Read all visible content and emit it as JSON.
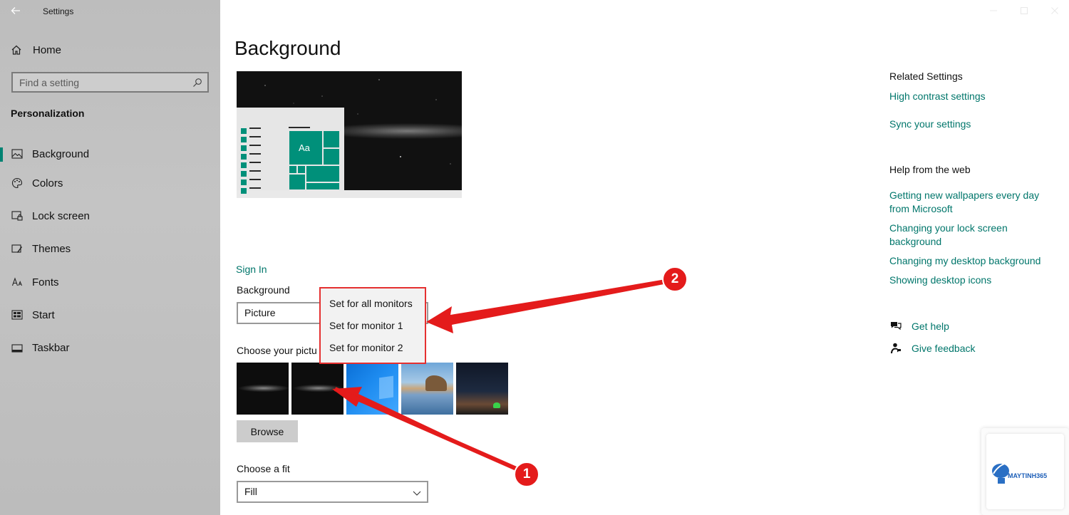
{
  "app": {
    "title": "Settings"
  },
  "sidebar": {
    "home_label": "Home",
    "search_placeholder": "Find a setting",
    "section_title": "Personalization",
    "items": [
      {
        "label": "Background",
        "icon": "picture-icon",
        "active": true
      },
      {
        "label": "Colors",
        "icon": "palette-icon"
      },
      {
        "label": "Lock screen",
        "icon": "lock-screen-icon"
      },
      {
        "label": "Themes",
        "icon": "themes-icon"
      },
      {
        "label": "Fonts",
        "icon": "fonts-icon"
      },
      {
        "label": "Start",
        "icon": "start-icon"
      },
      {
        "label": "Taskbar",
        "icon": "taskbar-icon"
      }
    ]
  },
  "main": {
    "title": "Background",
    "preview_tile_text": "Aa",
    "sign_in": "Sign In",
    "background_label": "Background",
    "background_value": "Picture",
    "choose_picture_label": "Choose your pictu",
    "browse_label": "Browse",
    "fit_label": "Choose a fit",
    "fit_value": "Fill"
  },
  "context_menu": {
    "items": [
      "Set for all monitors",
      "Set for monitor 1",
      "Set for monitor 2"
    ]
  },
  "related": {
    "heading": "Related Settings",
    "links": [
      "High contrast settings",
      "Sync your settings"
    ]
  },
  "help": {
    "heading": "Help from the web",
    "links": [
      "Getting new wallpapers every day from Microsoft",
      "Changing your lock screen background",
      "Changing my desktop background",
      "Showing desktop icons"
    ]
  },
  "support": {
    "get_help": "Get help",
    "give_feedback": "Give feedback"
  },
  "annotations": {
    "badge_1": "1",
    "badge_2": "2"
  },
  "watermark": {
    "brand": "MAYTINH365"
  },
  "colors": {
    "accent": "#00766b",
    "tile": "#00907a",
    "annotation": "#e41b1b"
  }
}
